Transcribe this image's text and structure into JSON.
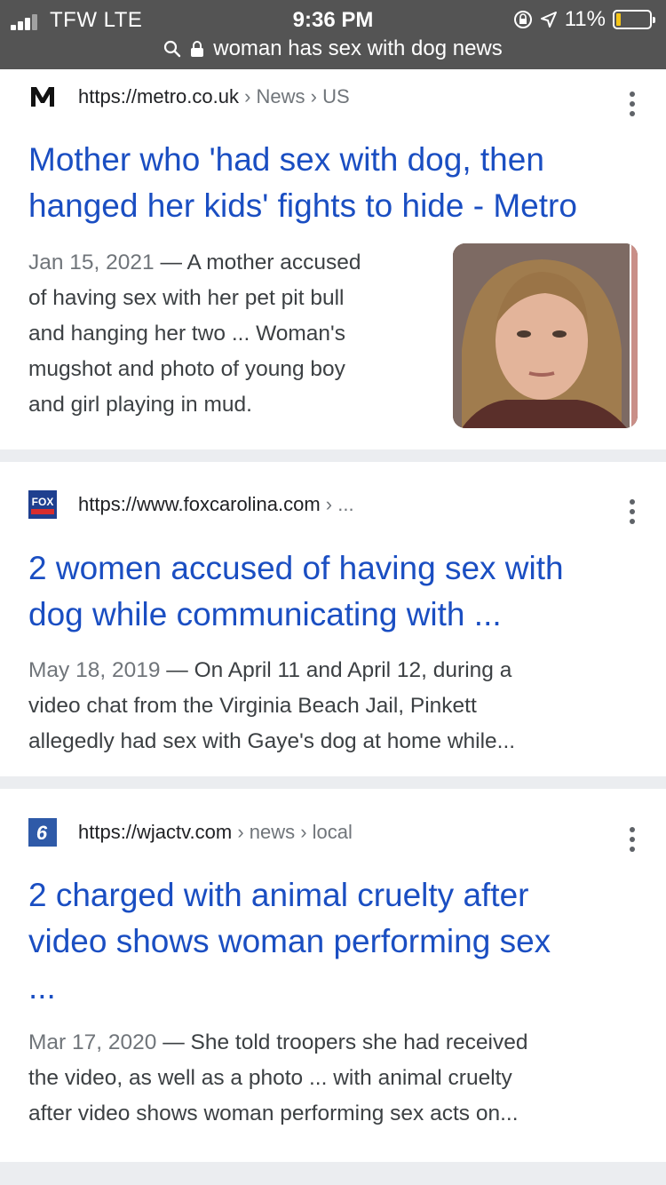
{
  "status_bar": {
    "carrier": "TFW  LTE",
    "time": "9:36 PM",
    "battery": "11%",
    "url": "woman has sex with dog news"
  },
  "results": [
    {
      "source_url": "https://metro.co.uk",
      "breadcrumbs": " › News › US",
      "title_line1": "Mother who 'had sex with dog, then",
      "title_line2": "hanged her kids' fights to hide - Metro",
      "date": "Jan 15, 2021",
      "snippet_lines": [
        "— A mother accused",
        "of having sex with her pet pit bull",
        "and hanging her two ... Woman's",
        "mugshot and photo of young boy",
        "and girl playing in mud."
      ],
      "favicon_text": "M"
    },
    {
      "source_url": "https://www.foxcarolina.com",
      "breadcrumbs": " › ...",
      "title_line1": "2 women accused of having sex with",
      "title_line2": "dog while communicating with ...",
      "date": "May 18, 2019",
      "snippet_lines": [
        "— On April 11 and April 12, during a",
        "video chat from the Virginia Beach Jail, Pinkett",
        "allegedly had sex with Gaye's dog at home while..."
      ],
      "favicon_text": "FOX"
    },
    {
      "source_url": "https://wjactv.com",
      "breadcrumbs": " › news › local",
      "title_line1": "2 charged with animal cruelty after",
      "title_line2": "video shows woman performing sex",
      "title_line3": "...",
      "date": "Mar 17, 2020",
      "snippet_lines": [
        "— She told troopers she had received",
        "the video, as well as a photo ... with animal cruelty",
        "after video shows woman performing sex acts on..."
      ],
      "favicon_text": "6"
    }
  ],
  "colors": {
    "link_blue": "#1a4ec2",
    "status_bar": "#545454",
    "page_bg": "#ebedf0"
  }
}
